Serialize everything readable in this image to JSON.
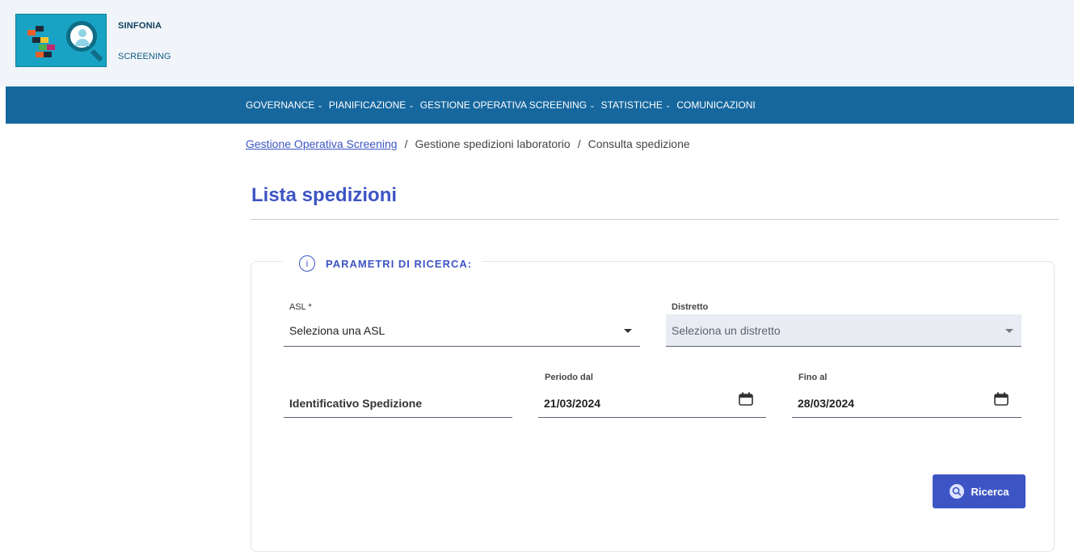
{
  "app": {
    "brand_line1": "SINFONIA",
    "brand_line2": "SCREENING"
  },
  "nav": {
    "items": [
      {
        "label": "GOVERNANCE",
        "has_menu": true
      },
      {
        "label": "PIANIFICAZIONE",
        "has_menu": true
      },
      {
        "label": "GESTIONE OPERATIVA SCREENING",
        "has_menu": true
      },
      {
        "label": "STATISTICHE",
        "has_menu": true
      },
      {
        "label": "COMUNICAZIONI",
        "has_menu": false
      }
    ],
    "chevron": "⌄"
  },
  "breadcrumb": {
    "link": "Gestione Operativa Screening",
    "separator": "/",
    "level2": "Gestione spedizioni laboratorio",
    "level3": "Consulta spedizione"
  },
  "page": {
    "title": "Lista spedizioni"
  },
  "search": {
    "legend": "PARAMETRI DI RICERCA:",
    "info_glyph": "i",
    "asl": {
      "label": "ASL *",
      "value": "Seleziona una ASL"
    },
    "distretto": {
      "label": "Distretto",
      "value": "Seleziona un distretto",
      "disabled": true
    },
    "identificativo": {
      "placeholder": "Identificativo Spedizione"
    },
    "periodo_dal": {
      "label": "Periodo dal",
      "value": "21/03/2024"
    },
    "fino_al": {
      "label": "Fino al",
      "value": "28/03/2024"
    },
    "button": {
      "label": "Ricerca"
    }
  },
  "colors": {
    "nav_bg": "#16679e",
    "accent": "#3d55c4",
    "topbar_bg": "#f1f5f9"
  },
  "icons": [
    "info-icon",
    "chevron-down-icon",
    "calendar-icon",
    "search-icon",
    "logo-magnifier-icon"
  ]
}
